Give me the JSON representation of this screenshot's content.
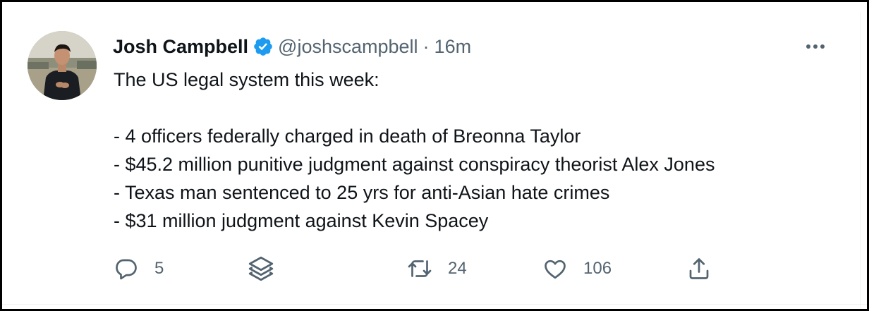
{
  "tweet": {
    "author_name": "Josh Campbell",
    "handle": "@joshscampbell",
    "separator": "·",
    "timestamp": "16m",
    "lines": [
      "The US legal system this week:",
      "",
      "- 4 officers federally charged in death of Breonna Taylor",
      "- $45.2 million punitive judgment against conspiracy theorist Alex Jones",
      "- Texas man sentenced to 25 yrs for anti-Asian hate crimes",
      "- $31 million judgment against Kevin Spacey"
    ]
  },
  "actions": {
    "reply_count": "5",
    "retweet_count": "24",
    "like_count": "106"
  },
  "icons": {
    "verified": "verified-badge-icon",
    "more": "more-horizontal-icon",
    "reply": "reply-icon",
    "stack": "layers-icon",
    "retweet": "retweet-icon",
    "like": "heart-icon",
    "share": "share-icon"
  },
  "colors": {
    "text_primary": "#0f1419",
    "text_secondary": "#536471",
    "verified_blue": "#1d9bf0",
    "frame_border": "#000000"
  }
}
